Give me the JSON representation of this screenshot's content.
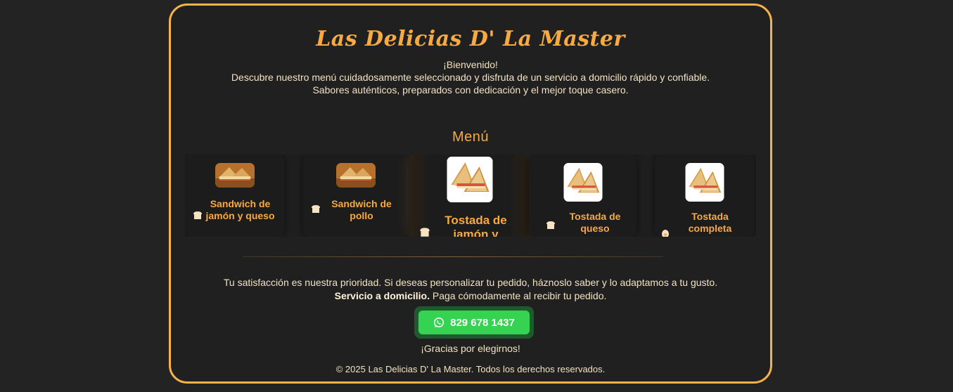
{
  "header": {
    "title": "Las Delicias D' La Master",
    "welcome": "¡Bienvenido!",
    "line1": "Descubre nuestro menú cuidadosamente seleccionado y disfruta de un servicio a domicilio rápido y confiable.",
    "line2": "Sabores auténticos, preparados con dedicación y el mejor toque casero."
  },
  "menu": {
    "heading": "Menú",
    "items": [
      {
        "name": "Sandwich de jamón y queso",
        "icon": "bread-icon"
      },
      {
        "name": "Sandwich de pollo",
        "icon": "bread-icon"
      },
      {
        "name": "Tostada de jamón y",
        "icon": "bread-icon"
      },
      {
        "name": "Tostada de queso",
        "icon": "bread-icon"
      },
      {
        "name": "Tostada completa",
        "icon": "egg-icon"
      }
    ]
  },
  "info": {
    "satisfaction": "Tu satisfacción es nuestra prioridad. Si deseas personalizar tu pedido, háznoslo saber y lo adaptamos a tu gusto.",
    "delivery_bold": "Servicio a domicilio.",
    "delivery_rest": " Paga cómodamente al recibir tu pedido."
  },
  "contact": {
    "phone": "829 678 1437",
    "icon": "whatsapp-icon",
    "color": "#36d352"
  },
  "thanks": "¡Gracias por elegirnos!",
  "footer": "© 2025 Las Delicias D' La Master. Todos los derechos reservados.",
  "colors": {
    "accent": "#f7a942",
    "border": "#f7b24a",
    "background": "#232323"
  }
}
